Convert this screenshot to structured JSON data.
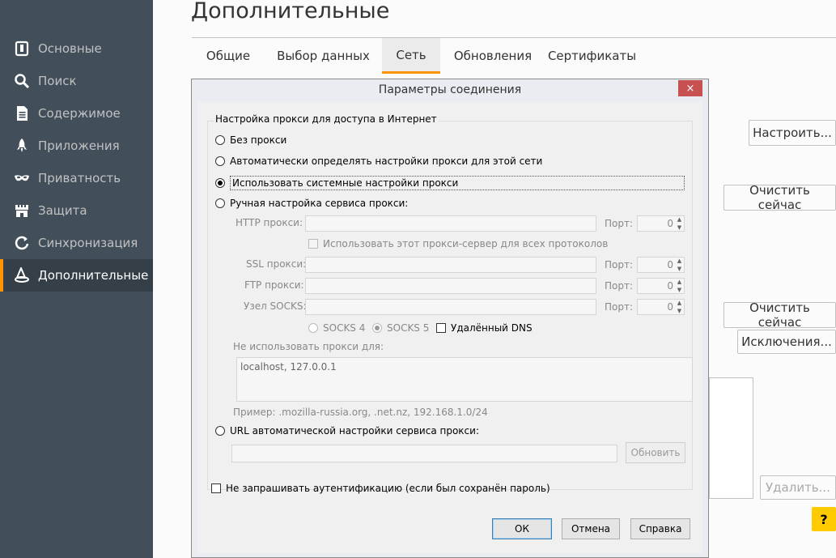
{
  "sidebar": {
    "items": [
      {
        "label": "Основные",
        "icon": "general-icon"
      },
      {
        "label": "Поиск",
        "icon": "search-icon"
      },
      {
        "label": "Содержимое",
        "icon": "content-icon"
      },
      {
        "label": "Приложения",
        "icon": "rocket-icon"
      },
      {
        "label": "Приватность",
        "icon": "mask-icon"
      },
      {
        "label": "Защита",
        "icon": "castle-icon"
      },
      {
        "label": "Синхронизация",
        "icon": "sync-icon"
      },
      {
        "label": "Дополнительные",
        "icon": "wizard-hat-icon"
      }
    ],
    "active_index": 7
  },
  "page": {
    "title": "Дополнительные",
    "tabs": [
      "Общие",
      "Выбор данных",
      "Сеть",
      "Обновления",
      "Сертификаты"
    ],
    "active_tab": 2,
    "buttons": {
      "configure": "Настроить...",
      "clear_now_1": "Очистить сейчас",
      "clear_now_2": "Очистить сейчас",
      "exceptions": "Исключения...",
      "remove": "Удалить..."
    },
    "help": "?"
  },
  "dialog": {
    "title": "Параметры соединения",
    "close": "×",
    "group_label": "Настройка прокси для доступа в Интернет",
    "options": {
      "no_proxy": "Без прокси",
      "auto_detect": "Автоматически определять настройки прокси для этой сети",
      "system": "Использовать системные настройки прокси",
      "manual": "Ручная настройка сервиса прокси:",
      "auto_url": "URL автоматической настройки сервиса прокси:"
    },
    "selected_option": "system",
    "manual": {
      "http_label": "HTTP прокси:",
      "ssl_label": "SSL прокси:",
      "ftp_label": "FTP прокси:",
      "socks_label": "Узел SOCKS:",
      "port_label": "Порт:",
      "http_port": "0",
      "ssl_port": "0",
      "ftp_port": "0",
      "socks_port": "0",
      "share_all": "Использовать этот прокси-сервер для всех протоколов",
      "socks4": "SOCKS 4",
      "socks5": "SOCKS 5",
      "remote_dns": "Удалённый DNS",
      "no_proxy_for": "Не использовать прокси для:",
      "no_proxy_value": "localhost, 127.0.0.1",
      "example": "Пример: .mozilla-russia.org, .net.nz, 192.168.1.0/24"
    },
    "reload": "Обновить",
    "no_auth_prompt": "Не запрашивать аутентификацию (если был сохранён пароль)",
    "ok": "ОК",
    "cancel": "Отмена",
    "help": "Справка"
  }
}
